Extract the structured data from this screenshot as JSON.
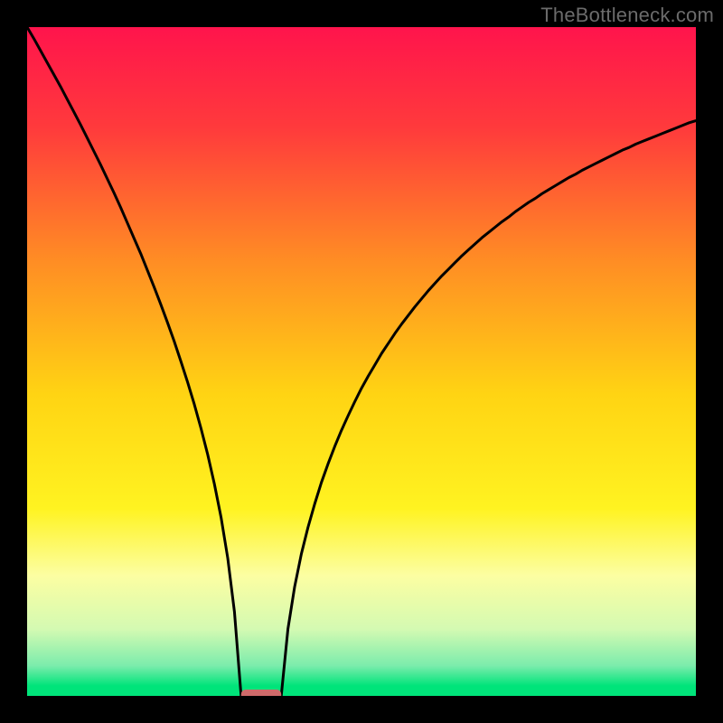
{
  "watermark": {
    "text": "TheBottleneck.com"
  },
  "chart_data": {
    "type": "line",
    "title": "",
    "xlabel": "",
    "ylabel": "",
    "xlim": [
      0,
      100
    ],
    "ylim": [
      0,
      100
    ],
    "x": [
      0,
      1,
      2,
      3,
      4,
      5,
      6,
      7,
      8,
      9,
      10,
      11,
      12,
      13,
      14,
      15,
      16,
      17,
      18,
      19,
      20,
      21,
      22,
      23,
      24,
      25,
      26,
      27,
      28,
      29,
      30,
      31,
      32,
      33,
      34,
      35,
      36,
      37,
      38,
      39,
      40,
      41,
      42,
      43,
      44,
      45,
      46,
      47,
      48,
      49,
      50,
      51,
      52,
      53,
      54,
      55,
      56,
      57,
      58,
      59,
      60,
      61,
      62,
      63,
      64,
      65,
      66,
      67,
      68,
      69,
      70,
      71,
      72,
      73,
      74,
      75,
      76,
      77,
      78,
      79,
      80,
      81,
      82,
      83,
      84,
      85,
      86,
      87,
      88,
      89,
      90,
      91,
      92,
      93,
      94,
      95,
      96,
      97,
      98,
      99,
      100
    ],
    "values": [
      100.0,
      98.3,
      96.5,
      94.7,
      92.9,
      91.1,
      89.2,
      87.3,
      85.4,
      83.4,
      81.4,
      79.4,
      77.3,
      75.2,
      73.0,
      70.7,
      68.4,
      66.1,
      63.6,
      61.1,
      58.5,
      55.8,
      53.0,
      50.0,
      46.9,
      43.6,
      40.0,
      36.1,
      31.7,
      26.7,
      20.6,
      12.6,
      0.0,
      0.0,
      0.0,
      0.0,
      0.0,
      0.0,
      0.0,
      10.0,
      16.3,
      21.2,
      25.2,
      28.7,
      31.9,
      34.7,
      37.3,
      39.7,
      41.9,
      44.0,
      46.0,
      47.8,
      49.5,
      51.2,
      52.7,
      54.2,
      55.6,
      56.9,
      58.2,
      59.4,
      60.6,
      61.7,
      62.8,
      63.8,
      64.8,
      65.8,
      66.7,
      67.6,
      68.5,
      69.3,
      70.1,
      70.9,
      71.6,
      72.4,
      73.1,
      73.8,
      74.4,
      75.1,
      75.7,
      76.3,
      76.9,
      77.5,
      78.0,
      78.6,
      79.1,
      79.6,
      80.1,
      80.6,
      81.1,
      81.6,
      82.0,
      82.5,
      82.9,
      83.3,
      83.7,
      84.1,
      84.5,
      84.9,
      85.3,
      85.7,
      86.0
    ],
    "marker": {
      "x_range": [
        32,
        38
      ],
      "y": 0,
      "color": "#cf6a6a"
    },
    "background_gradient": {
      "stops": [
        {
          "pos": 0.0,
          "color": "#ff144c"
        },
        {
          "pos": 0.15,
          "color": "#ff3a3c"
        },
        {
          "pos": 0.35,
          "color": "#ff8d24"
        },
        {
          "pos": 0.55,
          "color": "#ffd413"
        },
        {
          "pos": 0.72,
          "color": "#fff321"
        },
        {
          "pos": 0.82,
          "color": "#fcfea2"
        },
        {
          "pos": 0.9,
          "color": "#d4fab2"
        },
        {
          "pos": 0.955,
          "color": "#7becac"
        },
        {
          "pos": 0.985,
          "color": "#00e47a"
        },
        {
          "pos": 1.0,
          "color": "#00e47a"
        }
      ]
    }
  }
}
